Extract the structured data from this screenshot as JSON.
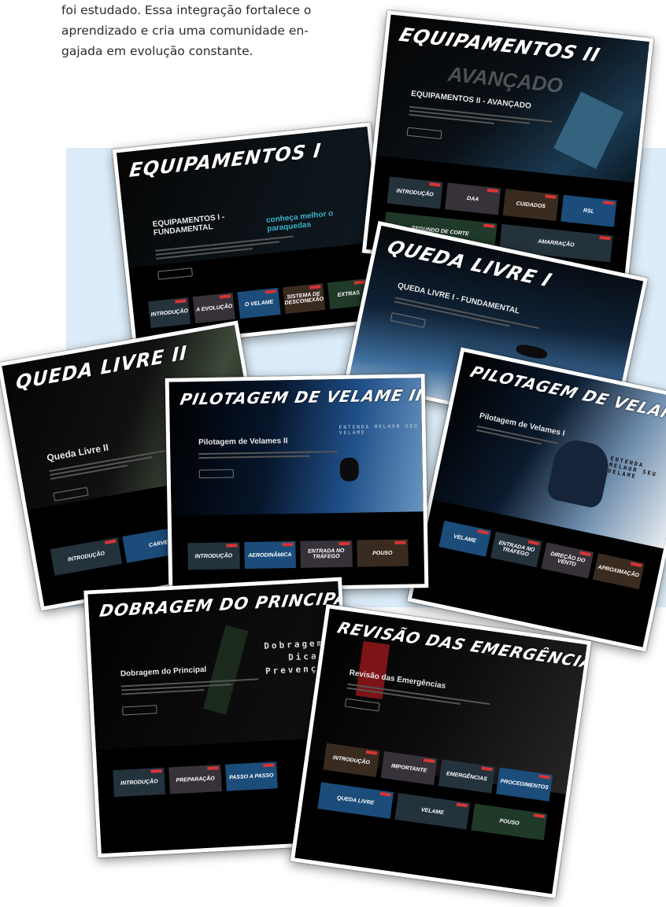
{
  "intro": {
    "lines": [
      "foi estudado. Essa integração fortalece o",
      "aprendizado e cria uma comunidade en-",
      "gajada em evolução constante."
    ]
  },
  "cards": {
    "equip1": {
      "title": "EQUIPAMENTOS I",
      "subtitle": "EQUIPAMENTOS I - FUNDAMENTAL",
      "tagline": "conheça melhor o paraquedas",
      "thumbs": [
        "INTRODUÇÃO",
        "A EVOLUÇÃO",
        "O VELAME",
        "SISTEMA DE DESCONEXÃO",
        "EXTRAS"
      ]
    },
    "equip2": {
      "title": "EQUIPAMENTOS II",
      "overlay": "AVANÇADO",
      "subtitle": "EQUIPAMENTOS II - AVANÇADO",
      "thumbs": [
        "INTRODUÇÃO",
        "DAA",
        "CUIDADOS",
        "RSL",
        "SEGUNDO DE CORTE",
        "AMARRAÇÃO"
      ]
    },
    "queda1": {
      "title": "QUEDA LIVRE I",
      "subtitle": "QUEDA LIVRE I - FUNDAMENTAL"
    },
    "queda2": {
      "title": "QUEDA LIVRE II",
      "subtitle": "Queda Livre II",
      "thumbs": [
        "INTRODUÇÃO",
        "CARVE"
      ]
    },
    "pilot2": {
      "title": "PILOTAGEM DE VELAME II",
      "subtitle": "Pilotagem de Velames II",
      "tagline": "ENTENDA MELHOR SEU VELAME",
      "thumbs": [
        "INTRODUÇÃO",
        "AERODINÂMICA",
        "ENTRADA NO TRÁFEGO",
        "POUSO"
      ]
    },
    "pilot1": {
      "title": "PILOTAGEM DE VELAME I",
      "subtitle": "Pilotagem de Velames I",
      "tagline": "ENTENDA MELHOR SEU VELAME",
      "thumbs": [
        "VELAME",
        "ENTRADA NO TRÁFEGO",
        "DIREÇÃO DO VENTO",
        "APROXIMAÇÃO"
      ]
    },
    "dobragem": {
      "title": "DOBRAGEM DO PRINCIPAL",
      "subtitle": "Dobragem do Principal",
      "tagline_lines": [
        "Dobragem",
        "Dicas",
        "Prevenção"
      ],
      "thumbs": [
        "INTRODUÇÃO",
        "PREPARAÇÃO",
        "PASSO A PASSO"
      ]
    },
    "revisao": {
      "title": "REVISÃO DAS EMERGÊNCIAS",
      "subtitle": "Revisão das Emergências",
      "thumbs": [
        "INTRODUÇÃO",
        "IMPORTANTE",
        "EMERGÊNCIAS",
        "PROCEDIMENTOS",
        "QUEDA LIVRE",
        "VELAME",
        "POUSO"
      ]
    }
  }
}
